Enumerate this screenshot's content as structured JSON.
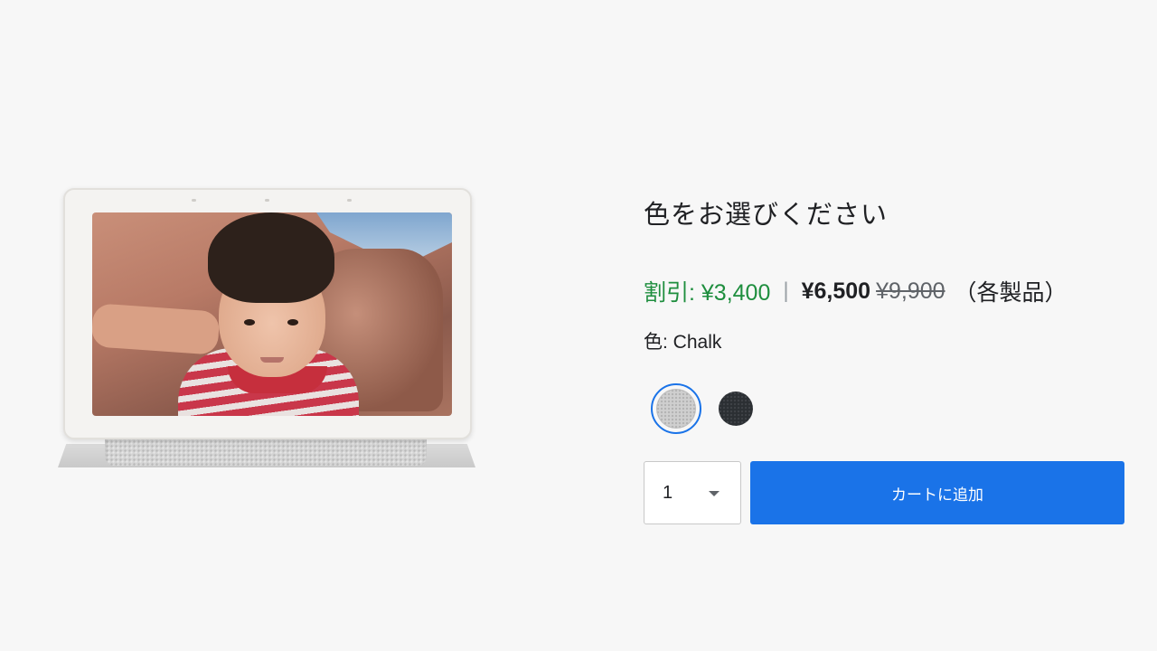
{
  "product": {
    "heading": "色をお選びください",
    "price": {
      "discount": "割引: ¥3,400",
      "separator": "|",
      "current": "¥6,500",
      "original": "¥9,900",
      "per_item": "（各製品）"
    },
    "color_label": "色: Chalk",
    "colors": [
      {
        "name": "Chalk",
        "hex": "#cfcfcf",
        "selected": true
      },
      {
        "name": "Charcoal",
        "hex": "#2b2f33",
        "selected": false
      }
    ],
    "quantity": "1",
    "add_to_cart_label": "カートに追加"
  },
  "colors": {
    "accent": "#1a73e8",
    "discount": "#1e8e3e",
    "background": "#f7f7f7"
  }
}
